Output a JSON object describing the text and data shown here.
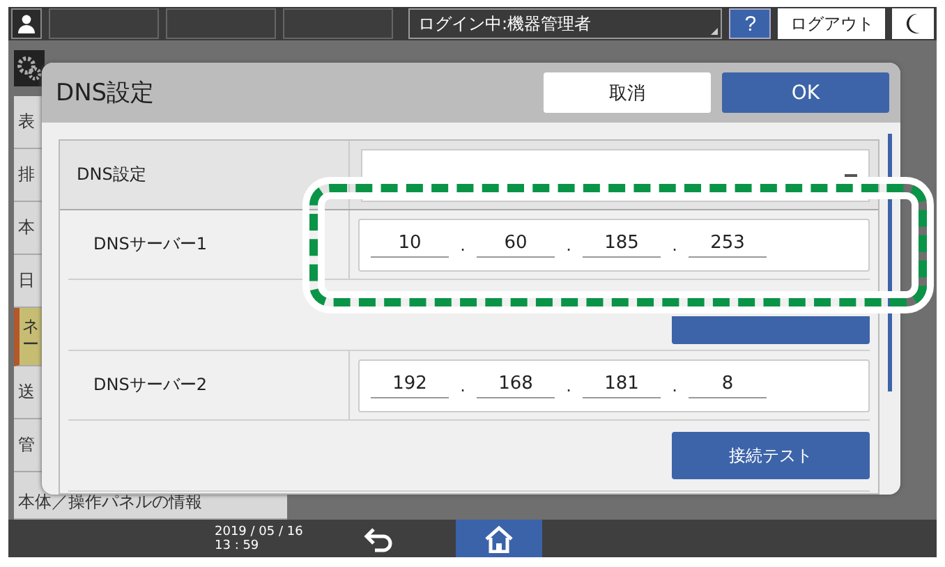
{
  "top_bar": {
    "login_status": "ログイン中:機器管理者",
    "help_button": "?",
    "logout_button": "ログアウト"
  },
  "sidebar": {
    "items": [
      {
        "label": "表",
        "selected": false
      },
      {
        "label": "排",
        "selected": false
      },
      {
        "label": "本",
        "selected": false
      },
      {
        "label": "日",
        "selected": false
      },
      {
        "label": "ネー",
        "selected": true
      },
      {
        "label": "送",
        "selected": false
      },
      {
        "label": "管",
        "selected": false
      },
      {
        "label": "本体／操作パネルの情報",
        "selected": false
      }
    ]
  },
  "dialog": {
    "title": "DNS設定",
    "cancel_button": "取消",
    "ok_button": "OK",
    "rows": [
      {
        "kind": "select",
        "label": "DNS設定"
      },
      {
        "kind": "ip",
        "label": "DNSサーバー1",
        "octets": [
          "10",
          "60",
          "185",
          "253"
        ],
        "separator": ".",
        "highlighted": true
      },
      {
        "kind": "ip",
        "label": "DNSサーバー2",
        "octets": [
          "192",
          "168",
          "181",
          "8"
        ],
        "separator": ".",
        "test_button": "接続テスト",
        "highlighted": false
      }
    ]
  },
  "status_bar": {
    "date": "2019 / 05 / 16",
    "time": "13 : 59"
  }
}
